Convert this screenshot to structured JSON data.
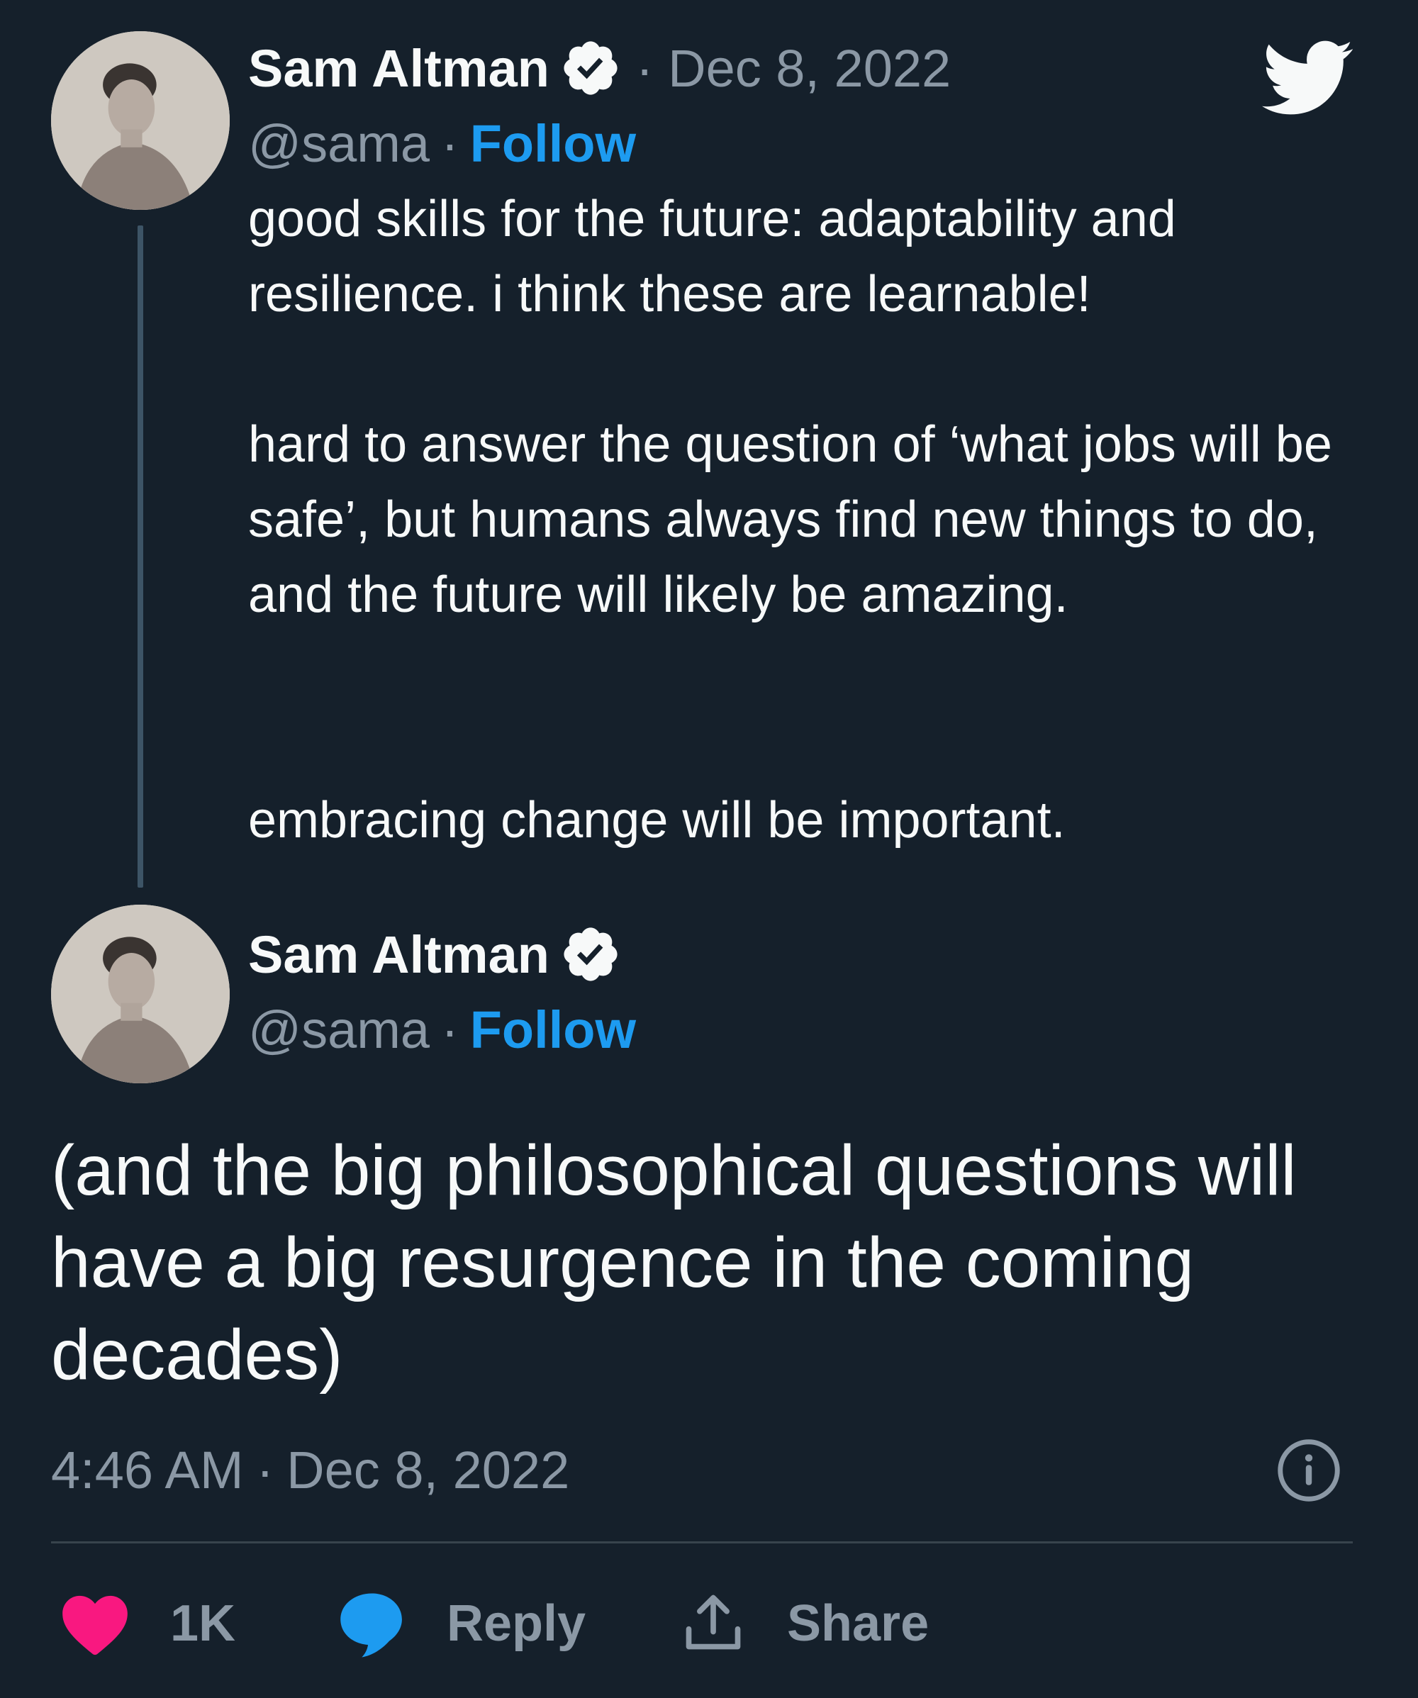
{
  "tweet1": {
    "author_name": "Sam Altman",
    "handle": "@sama",
    "follow_label": "Follow",
    "separator": "·",
    "date": "· Dec 8, 2022",
    "paragraphs": [
      "good skills for the future: adaptability and resilience. i think these are learnable!",
      "hard to answer the question of ‘what jobs will be safe’, but humans always find new things to do, and the future will likely be amazing.",
      "embracing change will be important."
    ]
  },
  "tweet2": {
    "author_name": "Sam Altman",
    "handle": "@sama",
    "follow_label": "Follow",
    "separator": "·",
    "text": "(and the big philosophical questions will have a big resurgence in the coming decades)",
    "time": "4:46 AM",
    "date": "Dec 8, 2022"
  },
  "actions": {
    "like_count": "1K",
    "reply_label": "Reply",
    "share_label": "Share"
  },
  "icons": {
    "brand": "twitter-bird-icon",
    "verified": "verified-badge-icon",
    "info": "info-icon",
    "like": "heart-icon",
    "reply": "speech-bubble-icon",
    "share": "share-upload-icon"
  },
  "colors": {
    "background": "#15202b",
    "text": "#f7f9f9",
    "muted": "#8b98a5",
    "accent": "#1d9bf0",
    "like": "#f91880",
    "thread_line": "#3d5466"
  }
}
